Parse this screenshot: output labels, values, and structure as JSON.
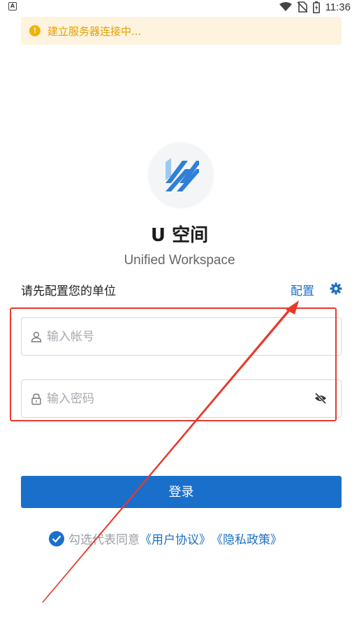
{
  "status_bar": {
    "time": "11:36",
    "icons": [
      "wifi-icon",
      "no-sim-icon",
      "battery-charging-icon"
    ]
  },
  "banner": {
    "icon": "warning-icon",
    "text": "建立服务器连接中..."
  },
  "app": {
    "title": "U 空间",
    "subtitle": "Unified  Workspace"
  },
  "org": {
    "prompt": "请先配置您的单位",
    "config_label": "配置",
    "config_icon": "gear-icon"
  },
  "form": {
    "account_placeholder": "输入帐号",
    "account_value": "",
    "password_placeholder": "输入密码",
    "password_value": "",
    "login_label": "登录"
  },
  "agreement": {
    "checked": true,
    "prefix": "勾选代表同意",
    "user_agreement": "《用户协议》",
    "privacy_policy": "《隐私政策》"
  },
  "colors": {
    "primary": "#1a6fcb",
    "warning_bg": "#fdf3df",
    "warning_text": "#e0a100",
    "annotation": "#e53a2d"
  }
}
